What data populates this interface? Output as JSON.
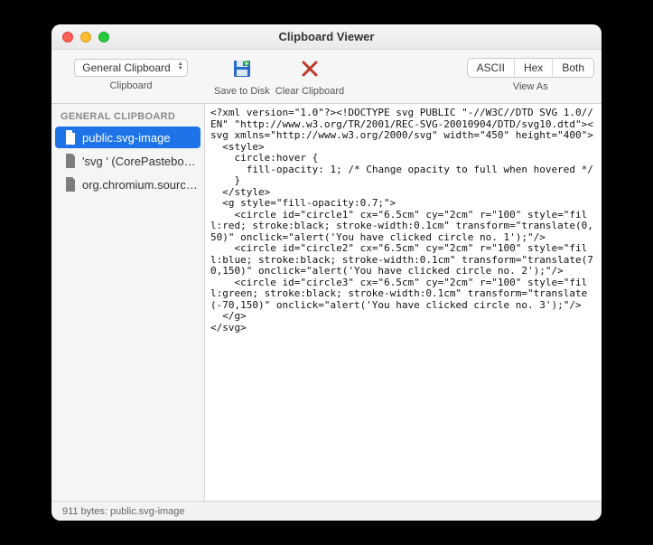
{
  "window": {
    "title": "Clipboard Viewer"
  },
  "toolbar": {
    "clipboard_selector": {
      "value": "General Clipboard",
      "label": "Clipboard"
    },
    "save_label": "Save to Disk",
    "clear_label": "Clear Clipboard",
    "viewas_label": "View As",
    "ascii": "ASCII",
    "hex": "Hex",
    "both": "Both"
  },
  "sidebar": {
    "header": "GENERAL CLIPBOARD",
    "items": [
      {
        "label": "public.svg-image",
        "selected": true
      },
      {
        "label": "'svg ' (CorePastebo…",
        "selected": false
      },
      {
        "label": "org.chromium.sourc…",
        "selected": false
      }
    ]
  },
  "content": {
    "text": "<?xml version=\"1.0\"?><!DOCTYPE svg PUBLIC \"-//W3C//DTD SVG 1.0//EN\" \"http://www.w3.org/TR/2001/REC-SVG-20010904/DTD/svg10.dtd\"><svg xmlns=\"http://www.w3.org/2000/svg\" width=\"450\" height=\"400\">\n  <style>\n    circle:hover {\n      fill-opacity: 1; /* Change opacity to full when hovered */\n    }\n  </style>\n  <g style=\"fill-opacity:0.7;\">\n    <circle id=\"circle1\" cx=\"6.5cm\" cy=\"2cm\" r=\"100\" style=\"fill:red; stroke:black; stroke-width:0.1cm\" transform=\"translate(0,50)\" onclick=\"alert('You have clicked circle no. 1');\"/>\n    <circle id=\"circle2\" cx=\"6.5cm\" cy=\"2cm\" r=\"100\" style=\"fill:blue; stroke:black; stroke-width:0.1cm\" transform=\"translate(70,150)\" onclick=\"alert('You have clicked circle no. 2');\"/>\n    <circle id=\"circle3\" cx=\"6.5cm\" cy=\"2cm\" r=\"100\" style=\"fill:green; stroke:black; stroke-width:0.1cm\" transform=\"translate(-70,150)\" onclick=\"alert('You have clicked circle no. 3');\"/>\n  </g>\n</svg>"
  },
  "status": {
    "text": "911 bytes: public.svg-image"
  }
}
